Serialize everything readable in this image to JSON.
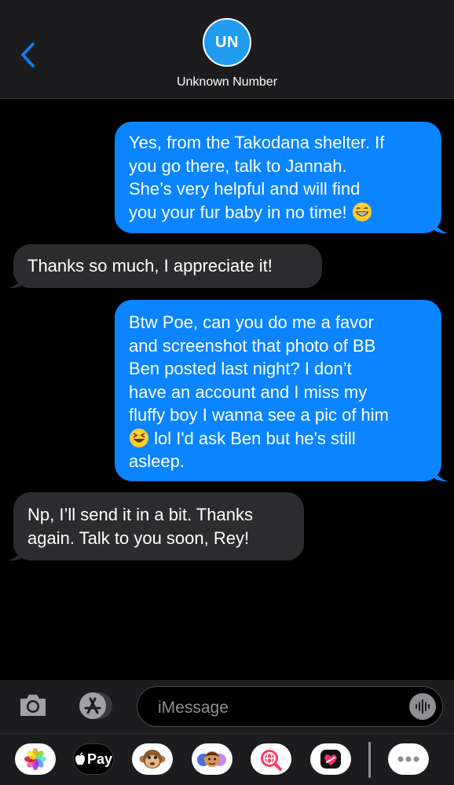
{
  "header": {
    "avatar_initials": "UN",
    "contact_name": "Unknown Number",
    "back_icon": "chevron-left-icon"
  },
  "messages": [
    {
      "direction": "outgoing",
      "text": "Yes, from the Takodana shelter. If\nyou go there, talk to Jannah.\nShe’s very helpful and will find\nyou your fur baby in no time!",
      "emoji": "grinning-face-emoji"
    },
    {
      "direction": "incoming",
      "text": "Thanks so much, I appreciate it!"
    },
    {
      "direction": "outgoing",
      "text_before_emoji": "Btw Poe, can you do me a favor\nand screenshot that photo of BB\nBen posted last night? I don’t\nhave an account and I miss my\nfluffy boy I wanna see a pic of him\n",
      "emoji": "laughing-face-emoji",
      "text_after_emoji": " lol I'd ask Ben but he's still\nasleep."
    },
    {
      "direction": "incoming",
      "text": "Np, I’ll send it in a bit. Thanks\nagain. Talk to you soon, Rey!"
    }
  ],
  "input_bar": {
    "placeholder": "iMessage",
    "camera_icon": "camera-icon",
    "apps_icon": "app-store-icon",
    "audio_icon": "waveform-icon"
  },
  "app_strip": {
    "apps": [
      {
        "name": "Photos",
        "icon": "photos-icon"
      },
      {
        "name": "Apple Pay",
        "label": "Pay",
        "icon": "apple-icon"
      },
      {
        "name": "Animoji",
        "icon": "monkey-icon"
      },
      {
        "name": "Memoji",
        "icon": "memoji-icon"
      },
      {
        "name": "Search",
        "icon": "globe-search-icon"
      },
      {
        "name": "Digital Touch",
        "icon": "heart-icon"
      },
      {
        "name": "More",
        "icon": "more-icon"
      }
    ]
  },
  "colors": {
    "outgoing_bubble": "#0a84ff",
    "incoming_bubble": "#2c2c2e",
    "avatar": "#1f9bef",
    "accent": "#0a84ff"
  }
}
